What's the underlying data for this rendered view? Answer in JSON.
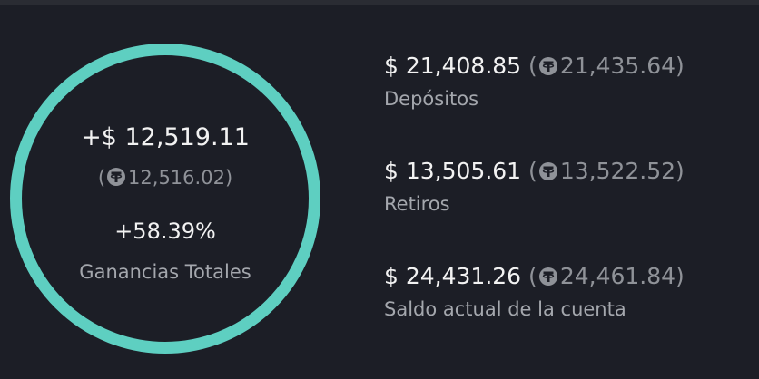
{
  "summary": {
    "profit_usd": "+$ 12,519.11",
    "paren_open": "(",
    "profit_usdt": "12,516.02",
    "paren_close": ")",
    "profit_percent": "+58.39%",
    "profit_label": "Ganancias Totales",
    "ring_color": "#5ecfc1",
    "usdt_icon": "tether-icon"
  },
  "stats": [
    {
      "usd": "$ 21,408.85",
      "usdt": "21,435.64",
      "label": "Depósitos"
    },
    {
      "usd": "$ 13,505.61",
      "usdt": "13,522.52",
      "label": "Retiros"
    },
    {
      "usd": "$ 24,431.26",
      "usdt": "24,461.84",
      "label": "Saldo actual de la cuenta"
    }
  ],
  "stat_paren_open": "(",
  "stat_paren_close": ")"
}
